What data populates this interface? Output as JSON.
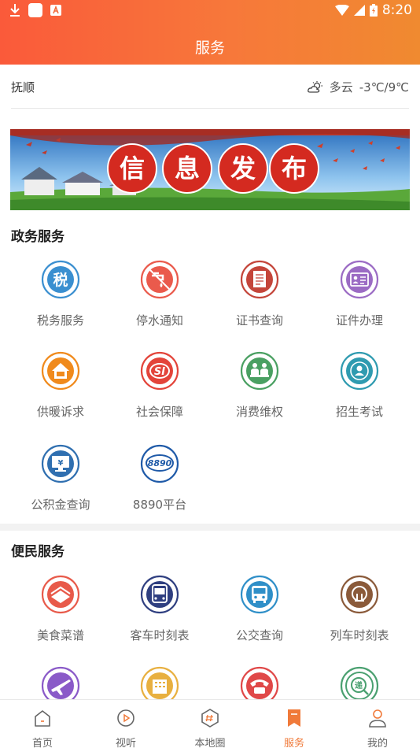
{
  "status_bar": {
    "time": "8:20"
  },
  "header": {
    "title": "服务"
  },
  "location": {
    "city": "抚顺",
    "weather_text": "多云",
    "temperature": "-3℃/9℃"
  },
  "banner": {
    "chars": [
      "信",
      "息",
      "发",
      "布"
    ]
  },
  "gov_section": {
    "title": "政务服务",
    "items": [
      {
        "label": "税务服务",
        "icon": "tax-icon",
        "color": "#3a8fd0"
      },
      {
        "label": "停水通知",
        "icon": "water-off-icon",
        "color": "#ea5a4c"
      },
      {
        "label": "证书查询",
        "icon": "certificate-icon",
        "color": "#c4453a"
      },
      {
        "label": "证件办理",
        "icon": "id-card-icon",
        "color": "#9b6bc4"
      },
      {
        "label": "供暖诉求",
        "icon": "heating-icon",
        "color": "#f08a1c"
      },
      {
        "label": "社会保障",
        "icon": "social-security-icon",
        "color": "#e3443a"
      },
      {
        "label": "消费维权",
        "icon": "consumer-rights-icon",
        "color": "#4aa062"
      },
      {
        "label": "招生考试",
        "icon": "exam-icon",
        "color": "#2f9bb0"
      },
      {
        "label": "公积金查询",
        "icon": "housing-fund-icon",
        "color": "#2f6fb0"
      },
      {
        "label": "8890平台",
        "icon": "platform-8890-icon",
        "color": "#1f5aa8"
      }
    ]
  },
  "civil_section": {
    "title": "便民服务",
    "items": [
      {
        "label": "美食菜谱",
        "icon": "recipe-icon",
        "color": "#e85a4a"
      },
      {
        "label": "客车时刻表",
        "icon": "coach-bus-icon",
        "color": "#2f3f80"
      },
      {
        "label": "公交查询",
        "icon": "city-bus-icon",
        "color": "#2f8fc8"
      },
      {
        "label": "列车时刻表",
        "icon": "train-icon",
        "color": "#8a5a3a"
      },
      {
        "label": "",
        "icon": "airplane-icon",
        "color": "#8a5ac8"
      },
      {
        "label": "",
        "icon": "hotel-icon",
        "color": "#e8b040"
      },
      {
        "label": "",
        "icon": "telephone-icon",
        "color": "#e04848"
      },
      {
        "label": "",
        "icon": "express-icon",
        "color": "#4aa070"
      }
    ]
  },
  "bottom_nav": {
    "items": [
      {
        "label": "首页",
        "icon": "home-icon"
      },
      {
        "label": "视听",
        "icon": "play-icon"
      },
      {
        "label": "本地圈",
        "icon": "hashtag-icon"
      },
      {
        "label": "服务",
        "icon": "bookmark-icon",
        "active": true
      },
      {
        "label": "我的",
        "icon": "user-icon"
      }
    ],
    "accent": "#f07a3a"
  }
}
